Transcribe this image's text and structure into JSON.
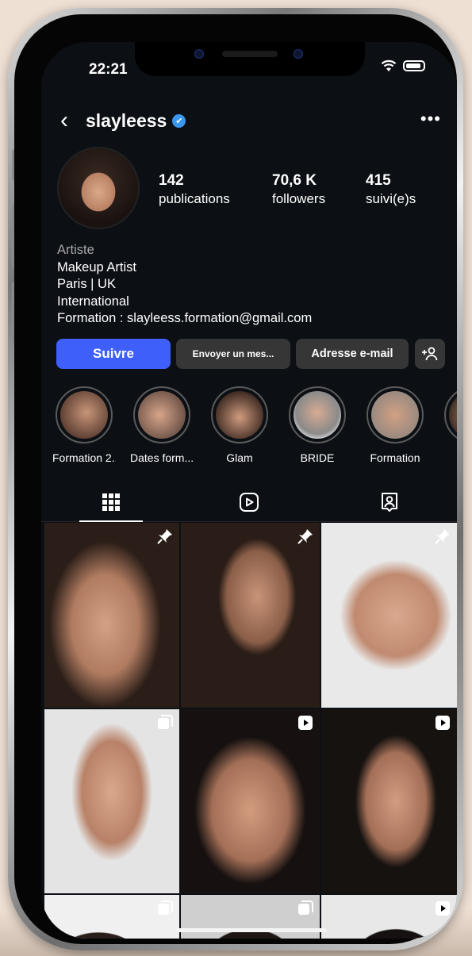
{
  "status_bar": {
    "time": "22:21"
  },
  "profile": {
    "username": "slayleess",
    "stats": [
      {
        "value": "142",
        "label": "publications"
      },
      {
        "value": "70,6 K",
        "label": "followers"
      },
      {
        "value": "415",
        "label": "suivi(e)s"
      }
    ],
    "category": "Artiste",
    "bio_lines": [
      "Makeup Artist",
      "Paris | UK",
      "International",
      "Formation : slayleess.formation@gmail.com"
    ]
  },
  "actions": {
    "follow": "Suivre",
    "message": "Envoyer un mes...",
    "email": "Adresse e-mail"
  },
  "highlights": [
    "Formation 2...",
    "Dates form...",
    "Glam",
    "BRIDE",
    "Formation"
  ],
  "tabs": [
    "grid-tab",
    "reels-tab",
    "tagged-tab"
  ],
  "posts": [
    {
      "badge": "pin-icon"
    },
    {
      "badge": "pin-icon"
    },
    {
      "badge": "pin-icon"
    },
    {
      "badge": "carousel-icon"
    },
    {
      "badge": "reel-icon"
    },
    {
      "badge": "reel-icon"
    },
    {
      "badge": "carousel-icon"
    },
    {
      "badge": "carousel-icon"
    },
    {
      "badge": "reel-icon"
    }
  ],
  "colors": {
    "follow_button": "#3f5ffa",
    "verified": "#3a97f0",
    "background": "#0c1014",
    "secondary_button": "#363636"
  }
}
